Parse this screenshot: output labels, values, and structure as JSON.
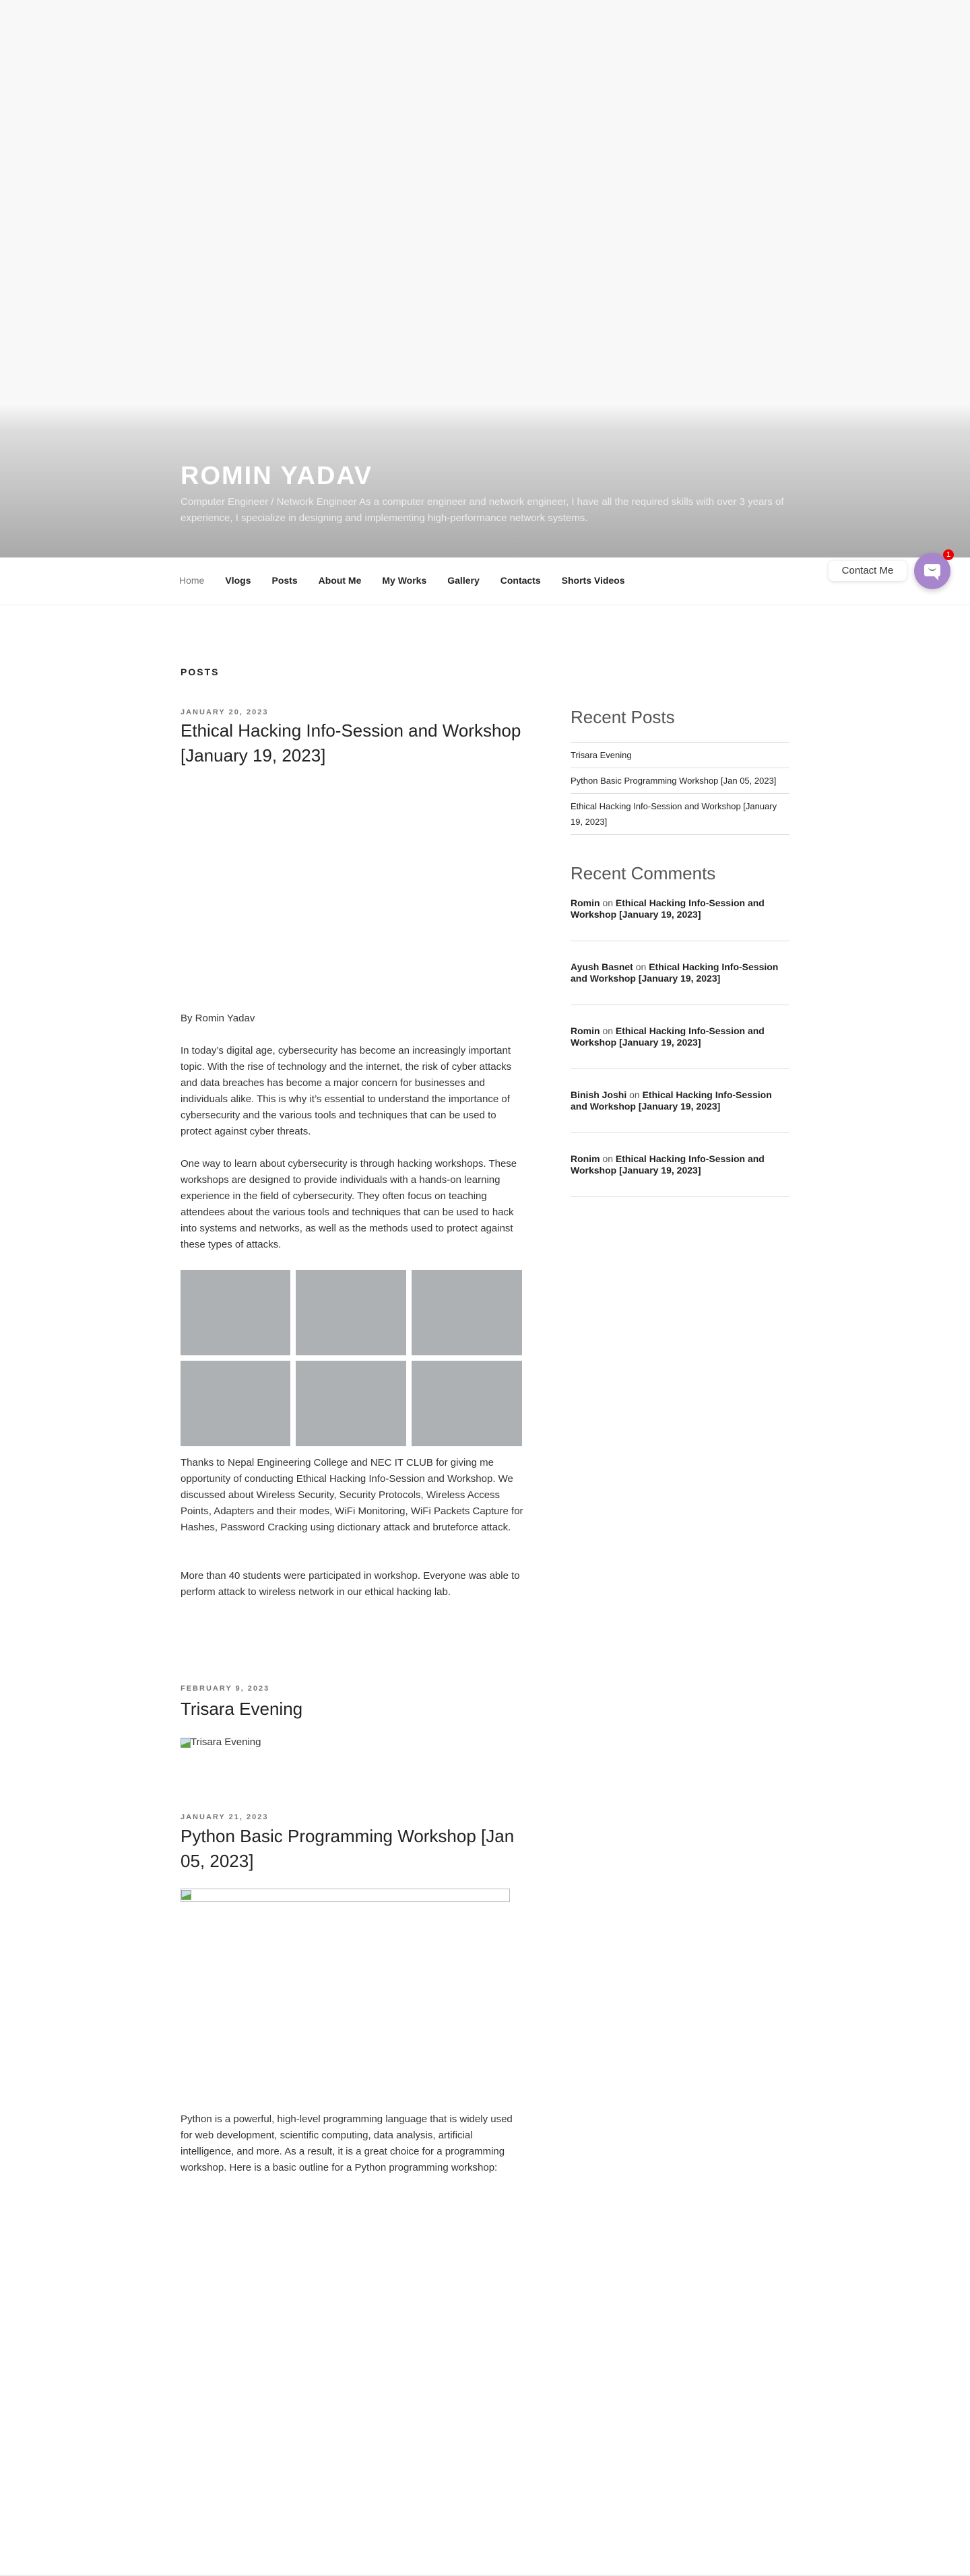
{
  "header": {
    "title": "ROMIN YADAV",
    "description": "Computer Engineer / Network Engineer As a computer engineer and network engineer, I have all the required skills with over 3 years of experience, I specialize in designing and implementing high-performance network systems."
  },
  "nav": {
    "items": [
      "Home",
      "Vlogs",
      "Posts",
      "About Me",
      "My Works",
      "Gallery",
      "Contacts",
      "Shorts Videos"
    ],
    "active": "Home"
  },
  "contact_widget": {
    "label": "Contact Me",
    "badge": "1",
    "color": "#a886cd",
    "icon": "chat-bubble-icon"
  },
  "page_title": "POSTS",
  "posts": [
    {
      "date": "JANUARY 20, 2023",
      "title": "Ethical Hacking Info-Session and Workshop [January 19, 2023]",
      "byline": "By Romin Yadav",
      "paragraphs": [
        "In today’s digital age, cybersecurity has become an increasingly important topic. With the rise of technology and the internet, the risk of cyber attacks and data breaches has become a major concern for businesses and individuals alike. This is why it’s essential to understand the importance of cybersecurity and the various tools and techniques that can be used to protect against cyber threats.",
        "One way to learn about cybersecurity is through hacking workshops. These workshops are designed to provide individuals with a hands-on learning experience in the field of cybersecurity. They often focus on teaching attendees about the various tools and techniques that can be used to hack into systems and networks, as well as the methods used to protect against these types of attacks.",
        "Thanks to Nepal Engineering College and NEC IT CLUB for giving me opportunity of conducting Ethical Hacking Info-Session and Workshop. We discussed about Wireless Security, Security Protocols, Wireless Access Points, Adapters and their modes, WiFi Monitoring, WiFi Packets Capture for Hashes, Password Cracking using dictionary attack and bruteforce attack.",
        "More than 40 students were participated in workshop. Everyone was able to perform attack to wireless network in our ethical hacking lab."
      ]
    },
    {
      "date": "FEBRUARY 9, 2023",
      "title": "Trisara Evening",
      "image_alt": "Trisara Evening"
    },
    {
      "date": "JANUARY 21, 2023",
      "title": "Python Basic Programming Workshop [Jan 05, 2023]",
      "paragraphs": [
        "Python is a powerful, high-level programming language that is widely used for web development, scientific computing, data analysis, artificial intelligence, and more. As a result, it is a great choice for a programming workshop. Here is a basic outline for a Python programming workshop:"
      ]
    }
  ],
  "sidebar": {
    "recent_posts_title": "Recent Posts",
    "recent_posts": [
      "Trisara Evening",
      "Python Basic Programming Workshop [Jan 05, 2023]",
      "Ethical Hacking Info-Session and Workshop [January 19, 2023]"
    ],
    "recent_comments_title": "Recent Comments",
    "on": "on",
    "recent_comments": [
      {
        "author": "Romin",
        "post": "Ethical Hacking Info-Session and Workshop [January 19, 2023]"
      },
      {
        "author": "Ayush Basnet",
        "post": "Ethical Hacking Info-Session and Workshop [January 19, 2023]"
      },
      {
        "author": "Romin",
        "post": "Ethical Hacking Info-Session and Workshop [January 19, 2023]"
      },
      {
        "author": "Binish Joshi",
        "post": "Ethical Hacking Info-Session and Workshop [January 19, 2023]"
      },
      {
        "author": "Ronim",
        "post": "Ethical Hacking Info-Session and Workshop [January 19, 2023]"
      }
    ]
  }
}
